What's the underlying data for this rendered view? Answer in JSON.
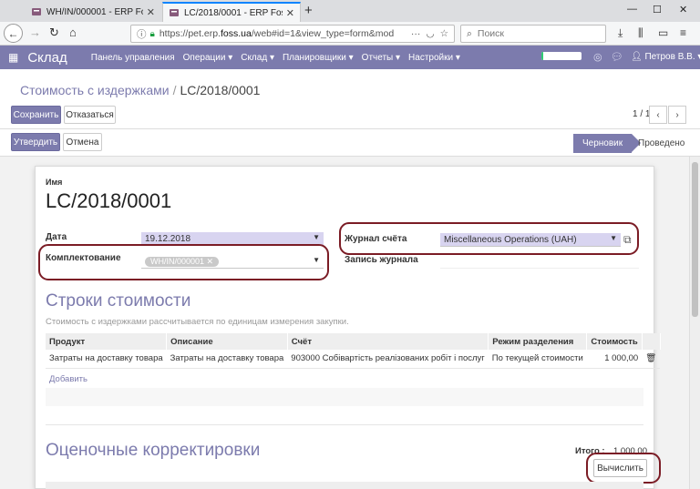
{
  "browser": {
    "tabs": [
      {
        "title": "WH/IN/000001 - ERP Foss",
        "active": false
      },
      {
        "title": "LC/2018/0001 - ERP Foss",
        "active": true
      }
    ],
    "url_prefix": "https://pet.erp.",
    "url_domain": "foss.ua",
    "url_rest": "/web#id=1&view_type=form&mod",
    "search_placeholder": "Поиск"
  },
  "app": {
    "name": "Склад",
    "menu": [
      "Панель управления",
      "Операции ▾",
      "Склад ▾",
      "Планировщики ▾",
      "Отчеты ▾",
      "Настройки ▾"
    ],
    "progress_fraction": 0.05,
    "user": "Петров В.В. ▾",
    "accent_color": "#7c7bad"
  },
  "breadcrumb": {
    "parent": "Стоимость с издержками",
    "current": "LC/2018/0001"
  },
  "buttons": {
    "save": "Сохранить",
    "discard": "Отказаться",
    "validate": "Утвердить",
    "cancel": "Отмена",
    "compute": "Вычислить"
  },
  "pager": {
    "text": "1 / 1"
  },
  "status": {
    "active": "Черновик",
    "next": "Проведено"
  },
  "form": {
    "name_label": "Имя",
    "name": "LC/2018/0001",
    "date_label": "Дата",
    "date": "19.12.2018",
    "picking_label": "Комплектование",
    "picking_tag": "WH/IN/000001",
    "journal_label": "Журнал счёта",
    "journal": "Miscellaneous Operations (UAH)",
    "move_label": "Запись журнала"
  },
  "cost_lines": {
    "title": "Строки стоимости",
    "hint": "Стоимость с издержками рассчитывается по единицам измерения закупки.",
    "columns": [
      "Продукт",
      "Описание",
      "Счёт",
      "Режим разделения",
      "Стоимость"
    ],
    "rows": [
      [
        "Затраты на доставку товара",
        "Затраты на доставку товара",
        "903000 Собівартість реалізованих робіт і послуг",
        "По текущей стоимости",
        "1 000,00"
      ]
    ],
    "add_label": "Добавить"
  },
  "valuation": {
    "title": "Оценочные корректировки",
    "total_label": "Итого :",
    "total_value": "1 000,00"
  }
}
